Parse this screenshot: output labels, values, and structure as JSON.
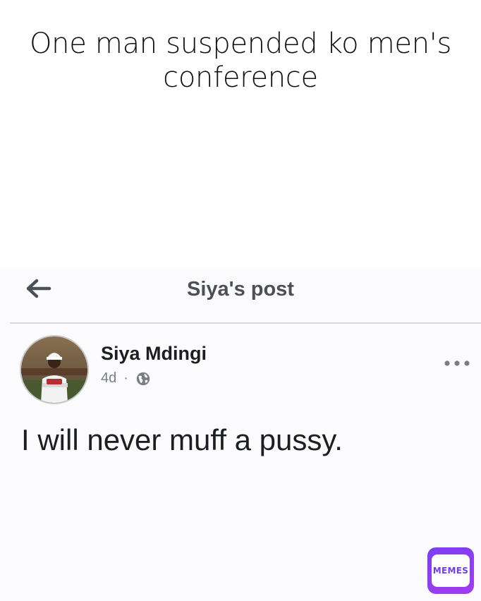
{
  "caption": "One man suspended ko men's conference",
  "header": {
    "title": "Siya's post",
    "back_icon": "arrow-left-icon"
  },
  "post": {
    "author": "Siya Mdingi",
    "time": "4d",
    "separator": "·",
    "privacy_icon": "globe-icon",
    "more_icon": "more-dots-icon",
    "text": "I will never muff a pussy."
  },
  "watermark": {
    "label": "MEMES"
  },
  "colors": {
    "accent": "#7b3ff2",
    "header_text": "#4b4f56",
    "meta_text": "#7a7d83"
  }
}
